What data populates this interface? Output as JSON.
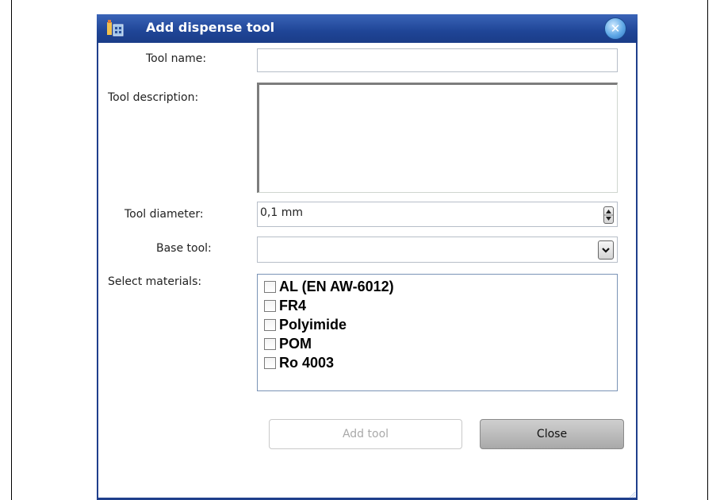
{
  "dialog": {
    "title": "Add dispense tool",
    "close_icon": "close-icon",
    "app_icon": "app-icon"
  },
  "form": {
    "tool_name_label": "Tool name:",
    "tool_name_value": "",
    "tool_description_label": "Tool description:",
    "tool_description_value": "",
    "tool_diameter_label": "Tool diameter:",
    "tool_diameter_value": "0,1 mm",
    "base_tool_label": "Base tool:",
    "base_tool_value": "",
    "select_materials_label": "Select materials:",
    "materials": [
      {
        "label": "AL (EN AW-6012)",
        "checked": false
      },
      {
        "label": "FR4",
        "checked": false
      },
      {
        "label": "Polyimide",
        "checked": false
      },
      {
        "label": "POM",
        "checked": false
      },
      {
        "label": "Ro 4003",
        "checked": false
      }
    ]
  },
  "buttons": {
    "add_tool_label": "Add tool",
    "add_tool_enabled": false,
    "close_label": "Close"
  },
  "colors": {
    "titlebar": "#1f4596",
    "frame": "#1f3f8c",
    "close_button": "#5fa8e6",
    "disabled_text": "#a9a9a9"
  }
}
